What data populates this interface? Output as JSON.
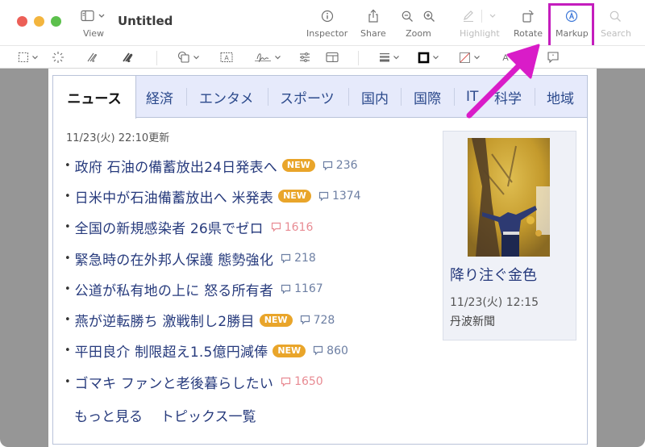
{
  "window": {
    "title": "Untitled"
  },
  "toolbar": {
    "view_label": "View",
    "inspector_label": "Inspector",
    "share_label": "Share",
    "zoom_label": "Zoom",
    "highlight_label": "Highlight",
    "rotate_label": "Rotate",
    "markup_label": "Markup",
    "search_label": "Search"
  },
  "markup_toolbar": {
    "tools": [
      "selection-tool",
      "instant-alpha",
      "sketch",
      "draw",
      "shapes",
      "text",
      "sign",
      "adjust-color",
      "adjust-size",
      "shape-style",
      "border-color",
      "fill-color",
      "text-style",
      "annotate"
    ]
  },
  "annotation": {
    "highlight_color": "#c41dbd",
    "target": "Markup"
  },
  "news": {
    "tabs": [
      {
        "label": "ニュース",
        "active": true
      },
      {
        "label": "経済"
      },
      {
        "label": "エンタメ"
      },
      {
        "label": "スポーツ"
      },
      {
        "label": "国内"
      },
      {
        "label": "国際"
      },
      {
        "label": "IT"
      },
      {
        "label": "科学"
      },
      {
        "label": "地域"
      }
    ],
    "updated": "11/23(火) 22:10更新",
    "items": [
      {
        "headline": "政府 石油の備蓄放出24日発表へ",
        "new": "NEW",
        "comments": "236",
        "hot": false
      },
      {
        "headline": "日米中が石油備蓄放出へ 米発表",
        "new": "NEW",
        "comments": "1374",
        "hot": false
      },
      {
        "headline": "全国の新規感染者 26県でゼロ",
        "new": null,
        "comments": "1616",
        "hot": true
      },
      {
        "headline": "緊急時の在外邦人保護 態勢強化",
        "new": null,
        "comments": "218",
        "hot": false
      },
      {
        "headline": "公道が私有地の上に 怒る所有者",
        "new": null,
        "comments": "1167",
        "hot": false
      },
      {
        "headline": "燕が逆転勝ち 激戦制し2勝目",
        "new": "NEW",
        "comments": "728",
        "hot": false
      },
      {
        "headline": "平田良介 制限超え1.5億円減俸",
        "new": "NEW",
        "comments": "860",
        "hot": false
      },
      {
        "headline": "ゴマキ ファンと老後暮らしたい",
        "new": null,
        "comments": "1650",
        "hot": true
      }
    ],
    "more_label": "もっと見る",
    "topics_label": "トピックス一覧",
    "photo": {
      "title": "降り注ぐ金色",
      "date": "11/23(火) 12:15",
      "source": "丹波新聞"
    }
  }
}
